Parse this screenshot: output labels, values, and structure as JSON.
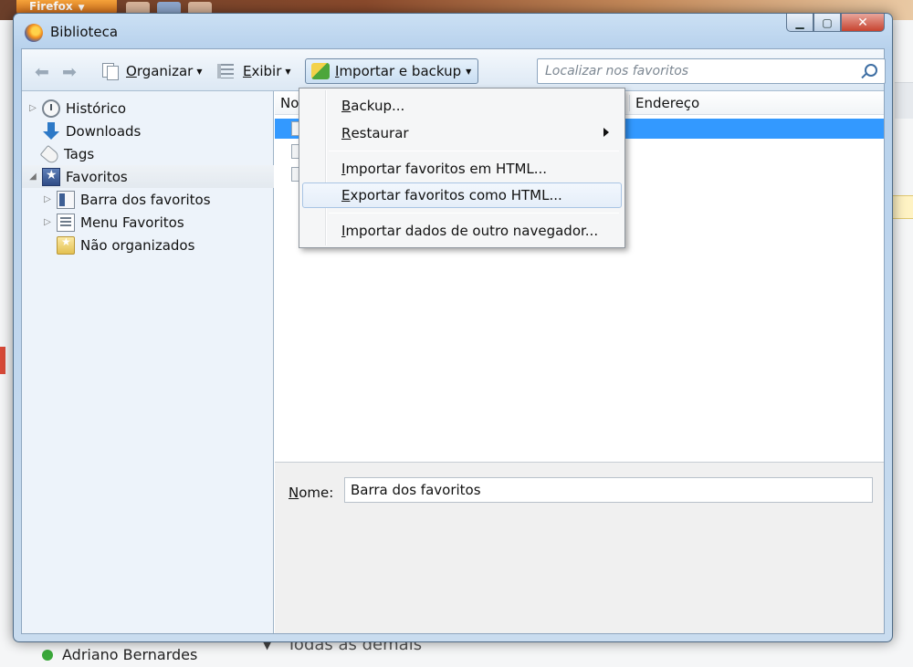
{
  "background": {
    "firefox_button": "Firefox",
    "user_name": "Adriano Bernardes",
    "section_label": "Todas as demais"
  },
  "window": {
    "title": "Biblioteca",
    "minimize": "▁",
    "maximize": "▢",
    "close": "✕"
  },
  "toolbar": {
    "organize_prefix": "O",
    "organize_rest": "rganizar",
    "view_prefix": "E",
    "view_rest": "xibir",
    "import_prefix": "I",
    "import_rest": "mportar e backup",
    "search_placeholder": "Localizar nos favoritos"
  },
  "sidebar": {
    "items": [
      {
        "label": "Histórico"
      },
      {
        "label": "Downloads"
      },
      {
        "label": "Tags"
      },
      {
        "label": "Favoritos"
      },
      {
        "label": "Barra dos favoritos"
      },
      {
        "label": "Menu Favoritos"
      },
      {
        "label": "Não organizados"
      }
    ]
  },
  "content": {
    "col_name": "No",
    "col_address": "Endereço"
  },
  "details": {
    "name_prefix": "N",
    "name_rest": "ome:",
    "name_value": "Barra dos favoritos"
  },
  "menu": {
    "items": [
      {
        "prefix": "B",
        "rest": "ackup..."
      },
      {
        "prefix": "R",
        "rest": "estaurar"
      },
      {
        "prefix": "I",
        "rest": "mportar favoritos em HTML..."
      },
      {
        "prefix": "E",
        "rest": "xportar favoritos como HTML..."
      },
      {
        "prefix": "I",
        "rest": "mportar dados de outro navegador..."
      }
    ]
  }
}
